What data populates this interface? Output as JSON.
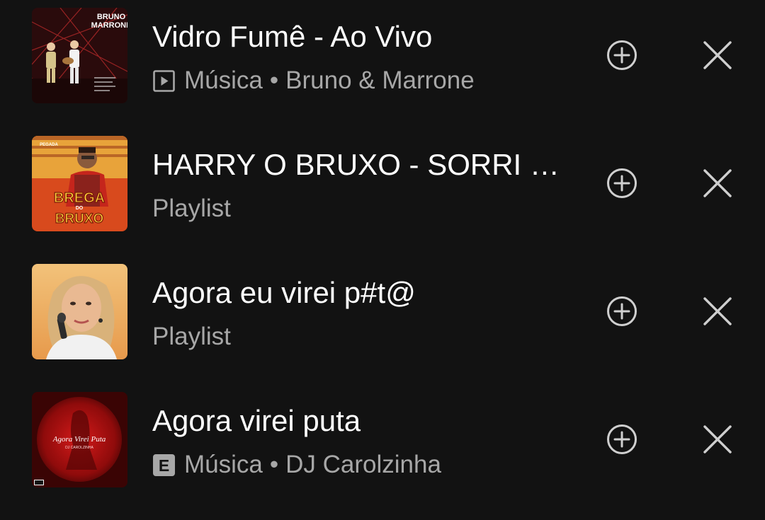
{
  "colors": {
    "background": "#121212",
    "title_text": "#ffffff",
    "meta_text": "#a7a7a7",
    "icon": "#cfcfcf"
  },
  "items": [
    {
      "title": "Vidro Fumê - Ao Vivo",
      "badge_icon": "video-badge-icon",
      "type_label": "Música",
      "separator": "•",
      "artist": "Bruno & Marrone",
      "cover_text": [
        "BRUNO",
        "MARRONE"
      ],
      "add_icon": "add-circle-icon",
      "remove_icon": "close-icon"
    },
    {
      "title": "HARRY O BRUXO - SORRI S...",
      "type_label": "Playlist",
      "cover_text": [
        "PEGADA",
        "BREGA",
        "DO",
        "BRUXO"
      ],
      "add_icon": "add-circle-icon",
      "remove_icon": "close-icon"
    },
    {
      "title": "Agora eu virei p#t@",
      "type_label": "Playlist",
      "add_icon": "add-circle-icon",
      "remove_icon": "close-icon"
    },
    {
      "title": "Agora virei puta",
      "badge_icon": "explicit-badge-icon",
      "badge_text": "E",
      "type_label": "Música",
      "separator": "•",
      "artist": "DJ Carolzinha",
      "cover_text": [
        "Agora Virei Puta",
        "DJ CAROLZINHA"
      ],
      "add_icon": "add-circle-icon",
      "remove_icon": "close-icon"
    }
  ]
}
